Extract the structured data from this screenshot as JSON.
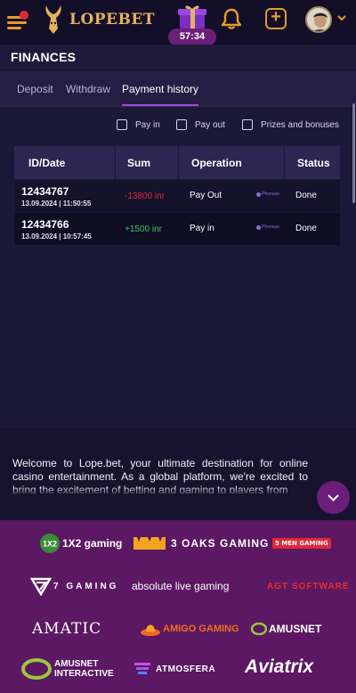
{
  "header": {
    "logo_text": "LOPEBET",
    "timer": "57:34"
  },
  "finances": {
    "title": "FINANCES",
    "tabs": [
      {
        "label": "Deposit",
        "active": false
      },
      {
        "label": "Withdraw",
        "active": false
      },
      {
        "label": "Payment history",
        "active": true
      }
    ],
    "filters": [
      {
        "label": "Pay in",
        "checked": false
      },
      {
        "label": "Pay out",
        "checked": false
      },
      {
        "label": "Prizes and bonuses",
        "checked": false
      }
    ],
    "table": {
      "columns": [
        "ID/Date",
        "Sum",
        "Operation",
        "Status"
      ],
      "rows": [
        {
          "id": "12434767",
          "date": "13.09.2024 | 11:50:55",
          "sum": "-13800 inr",
          "sum_color": "#e0283a",
          "operation": "Pay Out",
          "provider": "Phonepe",
          "status": "Done"
        },
        {
          "id": "12434766",
          "date": "13.09.2024 | 10:57:45",
          "sum": "+1500 inr",
          "sum_color": "#3cc26a",
          "operation": "Pay in",
          "provider": "Phonepe",
          "status": "Done"
        }
      ]
    }
  },
  "intro": {
    "text": "Welcome to Lope.bet, your ultimate destination for online casino entertainment. As a global platform, we're excited to bring the excitement of betting and gaming to players from"
  },
  "providers": {
    "items": [
      {
        "name": "1X2 gaming"
      },
      {
        "name": "3 OAKS GAMING"
      },
      {
        "name": "5 MEN GAMING"
      },
      {
        "name": "7 GAMING"
      },
      {
        "name": "absolute live gaming"
      },
      {
        "name": "AGT SOFTWARE"
      },
      {
        "name": "AMATIC"
      },
      {
        "name": "AMIGO GAMING"
      },
      {
        "name": "AMUSNET"
      },
      {
        "name": "AMUSNET INTERACTIVE"
      },
      {
        "name": "ATMOSFERA"
      },
      {
        "name": "Aviatrix"
      }
    ]
  },
  "colors": {
    "accent_orange": "#e69a2e",
    "accent_purple": "#a24bd6",
    "pay_out_red": "#e0283a",
    "pay_in_green": "#3cc26a",
    "providers_bg": "#5c1862"
  }
}
